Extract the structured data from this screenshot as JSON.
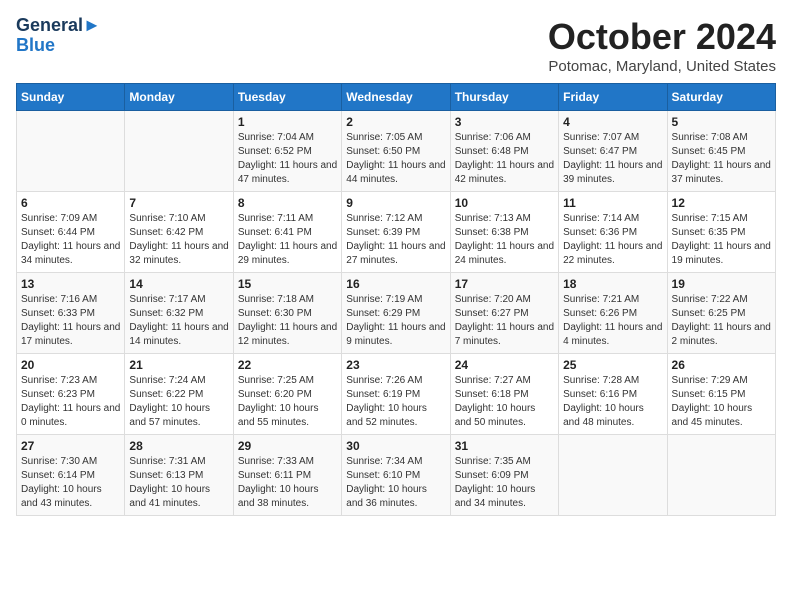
{
  "header": {
    "logo_line1": "General",
    "logo_line2": "Blue",
    "title": "October 2024",
    "location": "Potomac, Maryland, United States"
  },
  "days_of_week": [
    "Sunday",
    "Monday",
    "Tuesday",
    "Wednesday",
    "Thursday",
    "Friday",
    "Saturday"
  ],
  "weeks": [
    [
      {
        "day": "",
        "sunrise": "",
        "sunset": "",
        "daylight": ""
      },
      {
        "day": "",
        "sunrise": "",
        "sunset": "",
        "daylight": ""
      },
      {
        "day": "1",
        "sunrise": "Sunrise: 7:04 AM",
        "sunset": "Sunset: 6:52 PM",
        "daylight": "Daylight: 11 hours and 47 minutes."
      },
      {
        "day": "2",
        "sunrise": "Sunrise: 7:05 AM",
        "sunset": "Sunset: 6:50 PM",
        "daylight": "Daylight: 11 hours and 44 minutes."
      },
      {
        "day": "3",
        "sunrise": "Sunrise: 7:06 AM",
        "sunset": "Sunset: 6:48 PM",
        "daylight": "Daylight: 11 hours and 42 minutes."
      },
      {
        "day": "4",
        "sunrise": "Sunrise: 7:07 AM",
        "sunset": "Sunset: 6:47 PM",
        "daylight": "Daylight: 11 hours and 39 minutes."
      },
      {
        "day": "5",
        "sunrise": "Sunrise: 7:08 AM",
        "sunset": "Sunset: 6:45 PM",
        "daylight": "Daylight: 11 hours and 37 minutes."
      }
    ],
    [
      {
        "day": "6",
        "sunrise": "Sunrise: 7:09 AM",
        "sunset": "Sunset: 6:44 PM",
        "daylight": "Daylight: 11 hours and 34 minutes."
      },
      {
        "day": "7",
        "sunrise": "Sunrise: 7:10 AM",
        "sunset": "Sunset: 6:42 PM",
        "daylight": "Daylight: 11 hours and 32 minutes."
      },
      {
        "day": "8",
        "sunrise": "Sunrise: 7:11 AM",
        "sunset": "Sunset: 6:41 PM",
        "daylight": "Daylight: 11 hours and 29 minutes."
      },
      {
        "day": "9",
        "sunrise": "Sunrise: 7:12 AM",
        "sunset": "Sunset: 6:39 PM",
        "daylight": "Daylight: 11 hours and 27 minutes."
      },
      {
        "day": "10",
        "sunrise": "Sunrise: 7:13 AM",
        "sunset": "Sunset: 6:38 PM",
        "daylight": "Daylight: 11 hours and 24 minutes."
      },
      {
        "day": "11",
        "sunrise": "Sunrise: 7:14 AM",
        "sunset": "Sunset: 6:36 PM",
        "daylight": "Daylight: 11 hours and 22 minutes."
      },
      {
        "day": "12",
        "sunrise": "Sunrise: 7:15 AM",
        "sunset": "Sunset: 6:35 PM",
        "daylight": "Daylight: 11 hours and 19 minutes."
      }
    ],
    [
      {
        "day": "13",
        "sunrise": "Sunrise: 7:16 AM",
        "sunset": "Sunset: 6:33 PM",
        "daylight": "Daylight: 11 hours and 17 minutes."
      },
      {
        "day": "14",
        "sunrise": "Sunrise: 7:17 AM",
        "sunset": "Sunset: 6:32 PM",
        "daylight": "Daylight: 11 hours and 14 minutes."
      },
      {
        "day": "15",
        "sunrise": "Sunrise: 7:18 AM",
        "sunset": "Sunset: 6:30 PM",
        "daylight": "Daylight: 11 hours and 12 minutes."
      },
      {
        "day": "16",
        "sunrise": "Sunrise: 7:19 AM",
        "sunset": "Sunset: 6:29 PM",
        "daylight": "Daylight: 11 hours and 9 minutes."
      },
      {
        "day": "17",
        "sunrise": "Sunrise: 7:20 AM",
        "sunset": "Sunset: 6:27 PM",
        "daylight": "Daylight: 11 hours and 7 minutes."
      },
      {
        "day": "18",
        "sunrise": "Sunrise: 7:21 AM",
        "sunset": "Sunset: 6:26 PM",
        "daylight": "Daylight: 11 hours and 4 minutes."
      },
      {
        "day": "19",
        "sunrise": "Sunrise: 7:22 AM",
        "sunset": "Sunset: 6:25 PM",
        "daylight": "Daylight: 11 hours and 2 minutes."
      }
    ],
    [
      {
        "day": "20",
        "sunrise": "Sunrise: 7:23 AM",
        "sunset": "Sunset: 6:23 PM",
        "daylight": "Daylight: 11 hours and 0 minutes."
      },
      {
        "day": "21",
        "sunrise": "Sunrise: 7:24 AM",
        "sunset": "Sunset: 6:22 PM",
        "daylight": "Daylight: 10 hours and 57 minutes."
      },
      {
        "day": "22",
        "sunrise": "Sunrise: 7:25 AM",
        "sunset": "Sunset: 6:20 PM",
        "daylight": "Daylight: 10 hours and 55 minutes."
      },
      {
        "day": "23",
        "sunrise": "Sunrise: 7:26 AM",
        "sunset": "Sunset: 6:19 PM",
        "daylight": "Daylight: 10 hours and 52 minutes."
      },
      {
        "day": "24",
        "sunrise": "Sunrise: 7:27 AM",
        "sunset": "Sunset: 6:18 PM",
        "daylight": "Daylight: 10 hours and 50 minutes."
      },
      {
        "day": "25",
        "sunrise": "Sunrise: 7:28 AM",
        "sunset": "Sunset: 6:16 PM",
        "daylight": "Daylight: 10 hours and 48 minutes."
      },
      {
        "day": "26",
        "sunrise": "Sunrise: 7:29 AM",
        "sunset": "Sunset: 6:15 PM",
        "daylight": "Daylight: 10 hours and 45 minutes."
      }
    ],
    [
      {
        "day": "27",
        "sunrise": "Sunrise: 7:30 AM",
        "sunset": "Sunset: 6:14 PM",
        "daylight": "Daylight: 10 hours and 43 minutes."
      },
      {
        "day": "28",
        "sunrise": "Sunrise: 7:31 AM",
        "sunset": "Sunset: 6:13 PM",
        "daylight": "Daylight: 10 hours and 41 minutes."
      },
      {
        "day": "29",
        "sunrise": "Sunrise: 7:33 AM",
        "sunset": "Sunset: 6:11 PM",
        "daylight": "Daylight: 10 hours and 38 minutes."
      },
      {
        "day": "30",
        "sunrise": "Sunrise: 7:34 AM",
        "sunset": "Sunset: 6:10 PM",
        "daylight": "Daylight: 10 hours and 36 minutes."
      },
      {
        "day": "31",
        "sunrise": "Sunrise: 7:35 AM",
        "sunset": "Sunset: 6:09 PM",
        "daylight": "Daylight: 10 hours and 34 minutes."
      },
      {
        "day": "",
        "sunrise": "",
        "sunset": "",
        "daylight": ""
      },
      {
        "day": "",
        "sunrise": "",
        "sunset": "",
        "daylight": ""
      }
    ]
  ]
}
